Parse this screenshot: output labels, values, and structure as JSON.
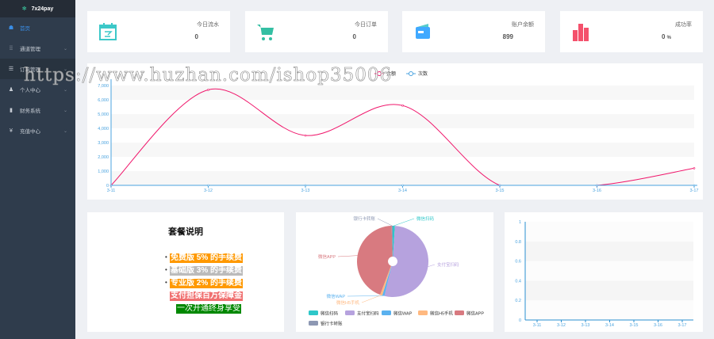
{
  "brand": "7x24pay",
  "sidebar": {
    "items": [
      {
        "label": "首页",
        "icon": "dashboard-icon"
      },
      {
        "label": "通道管理",
        "icon": "channel-icon"
      },
      {
        "label": "订单管理",
        "icon": "list-icon"
      },
      {
        "label": "个人中心",
        "icon": "user-icon"
      },
      {
        "label": "财务系统",
        "icon": "bar-chart-icon"
      },
      {
        "label": "充值中心",
        "icon": "yen-icon"
      }
    ]
  },
  "stats": [
    {
      "label": "今日流水",
      "value": "0",
      "color": "#3cc8c8"
    },
    {
      "label": "今日订单",
      "value": "0",
      "color": "#34bfa3"
    },
    {
      "label": "账户余额",
      "value": "899",
      "color": "#40a9ff"
    },
    {
      "label": "成功率",
      "value": "0",
      "unit": "%",
      "color": "#f4516c"
    }
  ],
  "watermark": "https://www.huzhan.com/ishop35006",
  "plan": {
    "title": "套餐说明",
    "lines": [
      {
        "text": "免费版 5% 的手续费",
        "bg": "#ff9900"
      },
      {
        "text": "基础版 3% 的手续费",
        "bg": "#bbbbbb"
      },
      {
        "text": "专业版 2% 的手续费",
        "bg": "#ff9900"
      },
      {
        "text": "支付担保百万保障金",
        "bg": "#f07070"
      },
      {
        "text": "一次开通终身享受",
        "bg": "#008800"
      }
    ]
  },
  "chart_data": [
    {
      "type": "line",
      "title": "",
      "categories": [
        "3-11",
        "3-12",
        "3-13",
        "3-14",
        "3-15",
        "3-16",
        "3-17"
      ],
      "series": [
        {
          "name": "金额",
          "color": "#f0166b",
          "values": [
            0,
            6700,
            3500,
            5600,
            0,
            0,
            1200
          ]
        },
        {
          "name": "次数",
          "color": "#4aa3df",
          "values": [
            0,
            0,
            0,
            0,
            0,
            0,
            0
          ]
        }
      ],
      "ylim": [
        0,
        7000
      ],
      "yticks": [
        "0",
        "1,000",
        "2,000",
        "3,000",
        "4,000",
        "5,000",
        "6,000",
        "7,000"
      ],
      "legend": "top"
    },
    {
      "type": "pie",
      "slices": [
        {
          "name": "微信扫码",
          "value": 1,
          "color": "#2ec7c9"
        },
        {
          "name": "支付宝扫码",
          "value": 53,
          "color": "#b6a2de"
        },
        {
          "name": "微信WAP",
          "value": 1,
          "color": "#5ab1ef"
        },
        {
          "name": "微信H5手机",
          "value": 1,
          "color": "#ffb980"
        },
        {
          "name": "微信APP",
          "value": 44,
          "color": "#d87a80"
        },
        {
          "name": "银行卡转账",
          "value": 0.5,
          "color": "#8d98b3"
        }
      ],
      "legend": "bottom"
    },
    {
      "type": "line",
      "categories": [
        "3-11",
        "3-12",
        "3-13",
        "3-14",
        "3-15",
        "3-16",
        "3-17"
      ],
      "series": [],
      "ylim": [
        0,
        1
      ],
      "yticks": [
        "0",
        "0.2",
        "0.4",
        "0.6",
        "0.8",
        "1"
      ]
    }
  ]
}
